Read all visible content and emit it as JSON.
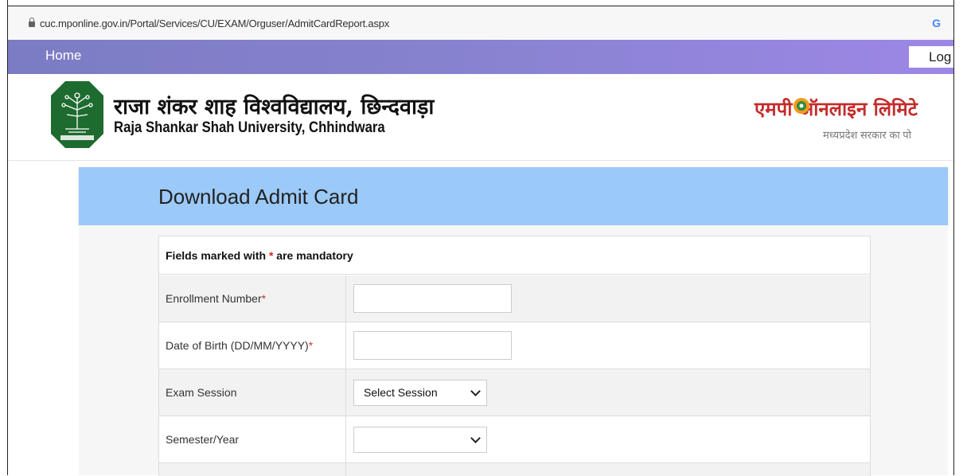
{
  "browser": {
    "url": "cuc.mponline.gov.in/Portal/Services/CU/EXAM/Orguser/AdmitCardReport.aspx",
    "google_icon": "G"
  },
  "nav": {
    "home": "Home",
    "login": "Log"
  },
  "header": {
    "university_hindi": "राजा शंकर शाह विश्वविद्यालय, छिन्दवाड़ा",
    "university_english": "Raja Shankar Shah University, Chhindwara",
    "mponline_logo_text": "एमपी ऑनलाइन लिमिटे",
    "mponline_tagline": "मध्यप्रदेश सरकार का पो"
  },
  "page": {
    "title": "Download Admit Card"
  },
  "form": {
    "mandatory_prefix": "Fields marked with ",
    "mandatory_star": "*",
    "mandatory_suffix": " are mandatory",
    "fields": [
      {
        "label": "Enrollment Number",
        "required": "*",
        "value": ""
      },
      {
        "label": "Date of Birth (DD/MM/YYYY)",
        "required": "*",
        "value": ""
      },
      {
        "label": "Exam Session",
        "selected": "Select Session"
      },
      {
        "label": "Semester/Year",
        "selected": ""
      }
    ]
  },
  "colors": {
    "nav_start": "#7b7cc3",
    "nav_end": "#9d87e6",
    "title_bar": "#9bc9f8",
    "required_star": "#e02020",
    "logo_green": "#1e6b2f"
  }
}
